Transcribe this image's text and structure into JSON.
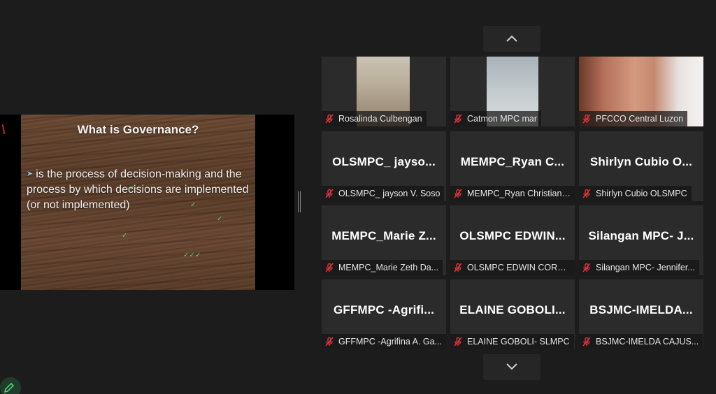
{
  "slide": {
    "title": "What is Governance?",
    "bullet": "is the process of decision-making and the process by which decisions are implemented (or not implemented)"
  },
  "gallery": {
    "tiles": [
      {
        "label": "Rosalinda Culbengan",
        "big": "",
        "video": true
      },
      {
        "label": "Catmon MPC mar",
        "big": "",
        "video": true
      },
      {
        "label": "PFCCO Central Luzon",
        "big": "",
        "video": true
      },
      {
        "label": "OLSMPC_ jayson V. Soso",
        "big": "OLSMPC_ jayso...",
        "video": false
      },
      {
        "label": "MEMPC_Ryan Christian ...",
        "big": "MEMPC_Ryan C...",
        "video": false
      },
      {
        "label": "Shirlyn Cubio OLSMPC",
        "big": "Shirlyn Cubio O...",
        "video": false
      },
      {
        "label": "MEMPC_Marie Zeth Da...",
        "big": "MEMPC_Marie Z...",
        "video": false
      },
      {
        "label": "OLSMPC EDWIN CORREA",
        "big": "OLSMPC EDWIN...",
        "video": false
      },
      {
        "label": "Silangan MPC- Jennifer...",
        "big": "Silangan MPC- J...",
        "video": false
      },
      {
        "label": "GFFMPC -Agrifina A. Ga...",
        "big": "GFFMPC -Agrifi...",
        "video": false
      },
      {
        "label": "ELAINE GOBOLI- SLMPC",
        "big": "ELAINE GOBOLI...",
        "video": false
      },
      {
        "label": "BSJMC-IMELDA CAJUS...",
        "big": "BSJMC-IMELDA...",
        "video": false
      }
    ]
  },
  "colors": {
    "background": "#1c1c1c",
    "tile": "#2b2b2b",
    "muted_mic": "#e0343c"
  },
  "icons": {
    "gallery_prev": "chevron-up-icon",
    "gallery_next": "chevron-down-icon",
    "tile_status": "muted-mic-icon",
    "annotate": "pencil-icon"
  }
}
